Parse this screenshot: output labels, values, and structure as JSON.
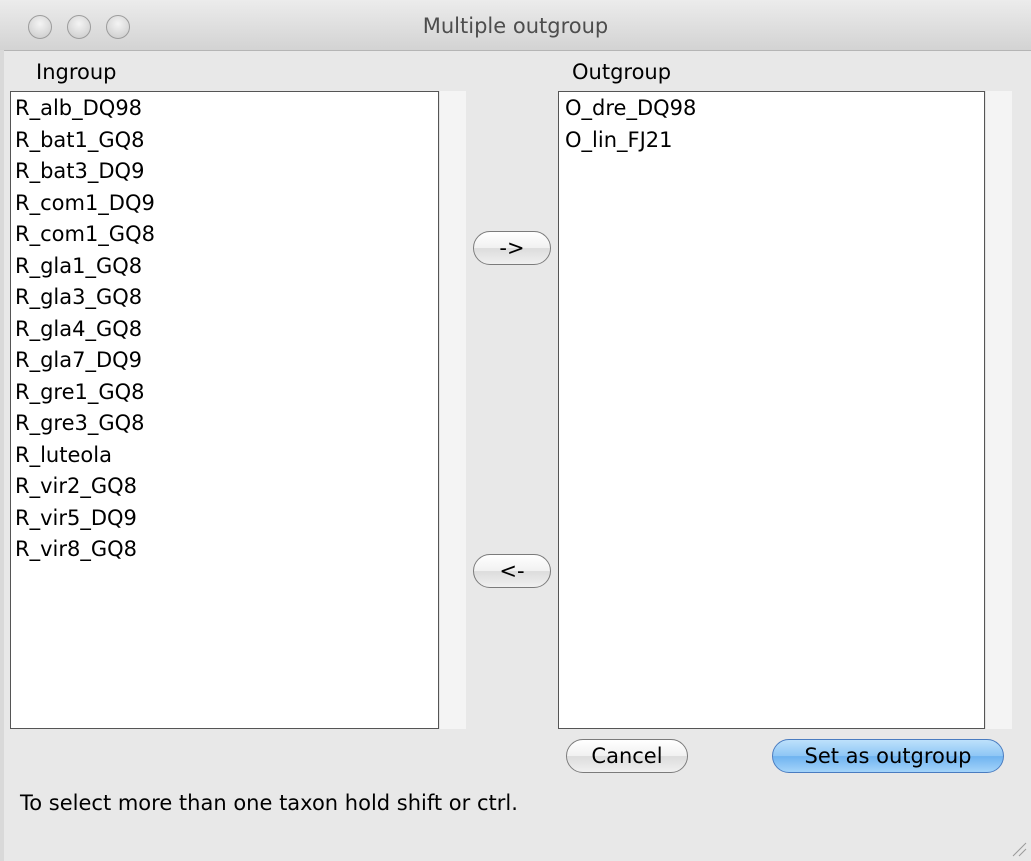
{
  "window": {
    "title": "Multiple outgroup"
  },
  "ingroup": {
    "label": "Ingroup",
    "items": [
      "R_alb_DQ98",
      "R_bat1_GQ8",
      "R_bat3_DQ9",
      "R_com1_DQ9",
      "R_com1_GQ8",
      "R_gla1_GQ8",
      "R_gla3_GQ8",
      "R_gla4_GQ8",
      "R_gla7_DQ9",
      "R_gre1_GQ8",
      "R_gre3_GQ8",
      "R_luteola",
      "R_vir2_GQ8",
      "R_vir5_DQ9",
      "R_vir8_GQ8"
    ]
  },
  "outgroup": {
    "label": "Outgroup",
    "items": [
      "O_dre_DQ98",
      "O_lin_FJ21"
    ]
  },
  "buttons": {
    "move_right": "->",
    "move_left": "<-",
    "cancel": "Cancel",
    "set_outgroup": "Set as outgroup"
  },
  "status": {
    "hint": "To select more than one taxon hold shift or ctrl."
  },
  "colors": {
    "default_button": "#6fb3f0",
    "list_border": "#555555"
  }
}
